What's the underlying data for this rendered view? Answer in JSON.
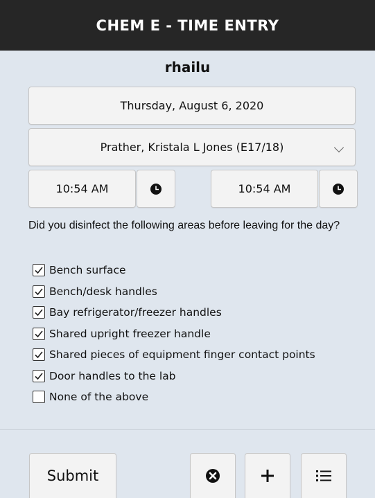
{
  "header": {
    "title": "CHEM E - TIME ENTRY"
  },
  "user": {
    "name": "rhailu"
  },
  "form": {
    "date": "Thursday, August 6, 2020",
    "supervisor": "Prather, Kristala L Jones (E17/18)",
    "start_time": "10:54 AM",
    "end_time": "10:54 AM",
    "question": "Did you disinfect the following areas before leaving for the day?",
    "checklist": [
      {
        "label": "Bench surface",
        "checked": true
      },
      {
        "label": "Bench/desk handles",
        "checked": true
      },
      {
        "label": "Bay refrigerator/freezer handles",
        "checked": true
      },
      {
        "label": "Shared upright freezer handle",
        "checked": true
      },
      {
        "label": "Shared pieces of equipment finger contact points",
        "checked": true
      },
      {
        "label": "Door handles to the lab",
        "checked": true
      },
      {
        "label": "None of the above",
        "checked": false
      }
    ]
  },
  "footer": {
    "submit_label": "Submit",
    "icons": [
      "cancel-circle-icon",
      "plus-icon",
      "list-icon"
    ]
  },
  "colors": {
    "header_bg": "#262626",
    "page_bg": "#dfe6ee",
    "button_bg": "#f3f3f3"
  }
}
